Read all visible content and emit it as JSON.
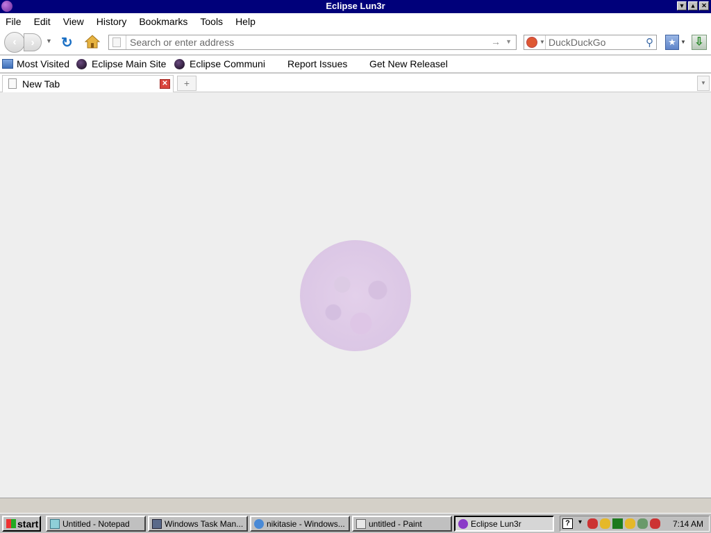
{
  "window": {
    "title": "Eclipse Lun3r"
  },
  "menu": [
    "File",
    "Edit",
    "View",
    "History",
    "Bookmarks",
    "Tools",
    "Help"
  ],
  "nav": {
    "address_placeholder": "Search or enter address",
    "search_placeholder": "DuckDuckGo"
  },
  "bookmarks": [
    "Most Visited",
    "Eclipse Main Site",
    "Eclipse Communi",
    "Report Issues",
    "Get New Releasel"
  ],
  "tabs": [
    {
      "label": "New Tab"
    }
  ],
  "taskbar": {
    "start_label": "start",
    "tasks": [
      "Untitled - Notepad",
      "Windows Task Man...",
      "nikitasie - Windows...",
      "untitled - Paint",
      "Eclipse Lun3r"
    ],
    "clock": "7:14 AM"
  },
  "colors": {
    "titlebar": "#00007a",
    "content_bg": "#eeeeee",
    "moon": "#dcc6e6"
  },
  "icons": [
    "eclipse-app-icon",
    "back-icon",
    "forward-icon",
    "reload-icon",
    "home-icon",
    "search-icon",
    "bookmark-star-icon",
    "downloads-icon",
    "folder-icon",
    "page-icon",
    "close-icon",
    "plus-icon"
  ]
}
